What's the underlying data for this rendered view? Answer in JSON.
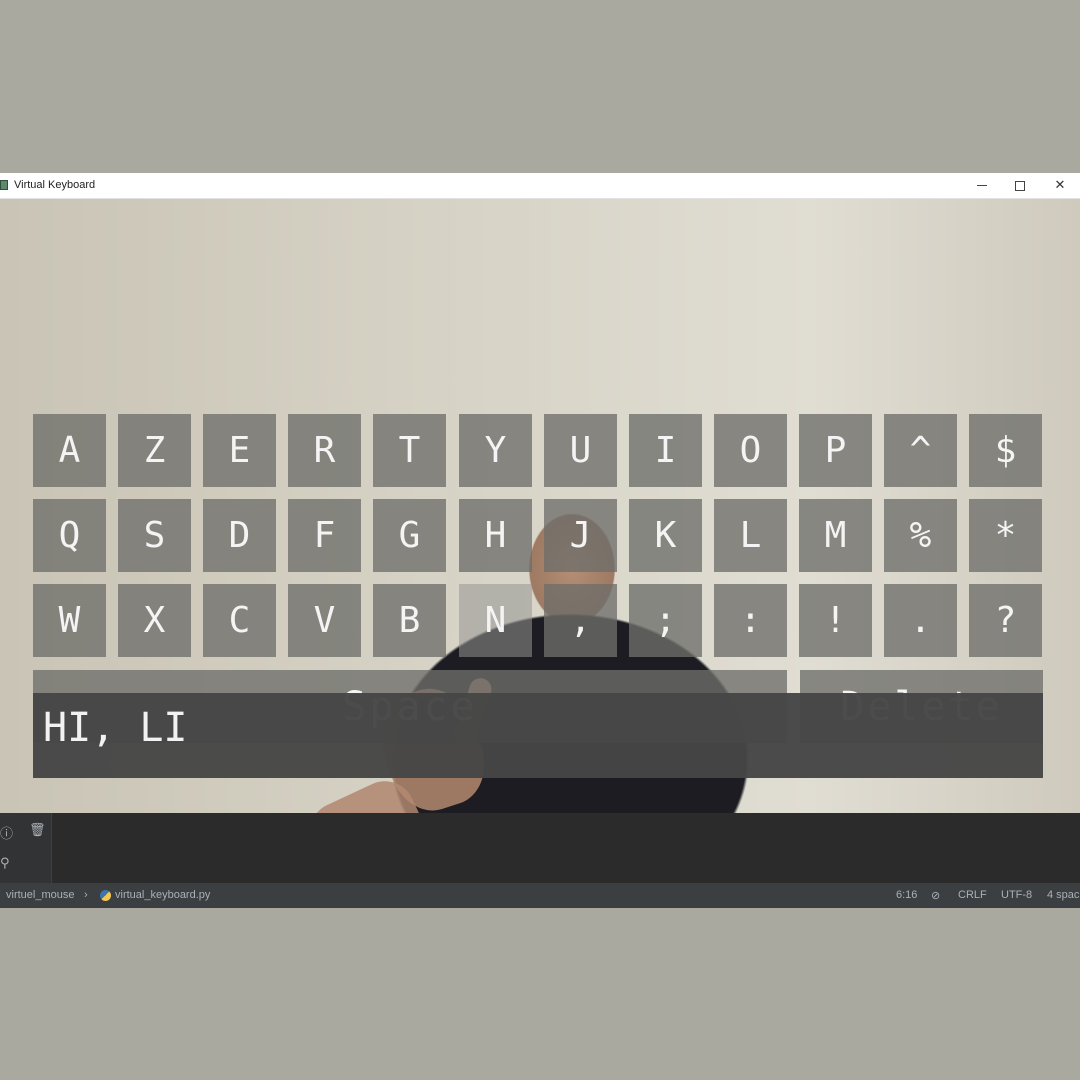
{
  "window": {
    "title": "Virtual Keyboard"
  },
  "keyboard": {
    "row1": [
      "A",
      "Z",
      "E",
      "R",
      "T",
      "Y",
      "U",
      "I",
      "O",
      "P",
      "^",
      "$"
    ],
    "row2": [
      "Q",
      "S",
      "D",
      "F",
      "G",
      "H",
      "J",
      "K",
      "L",
      "M",
      "%",
      "*"
    ],
    "row3": [
      "W",
      "X",
      "C",
      "V",
      "B",
      "N",
      ",",
      ";",
      ":",
      "!",
      ".",
      "?"
    ],
    "space_label": "Space",
    "delete_label": "Delete",
    "pressed_key": "N"
  },
  "typed_text": "HI, LI",
  "ide": {
    "breadcrumb_project": "virtuel_mouse",
    "breadcrumb_file": "virtual_keyboard.py",
    "cursor_position": "6:16",
    "line_separator": "CRLF",
    "encoding": "UTF-8",
    "indent": "4 spac"
  }
}
